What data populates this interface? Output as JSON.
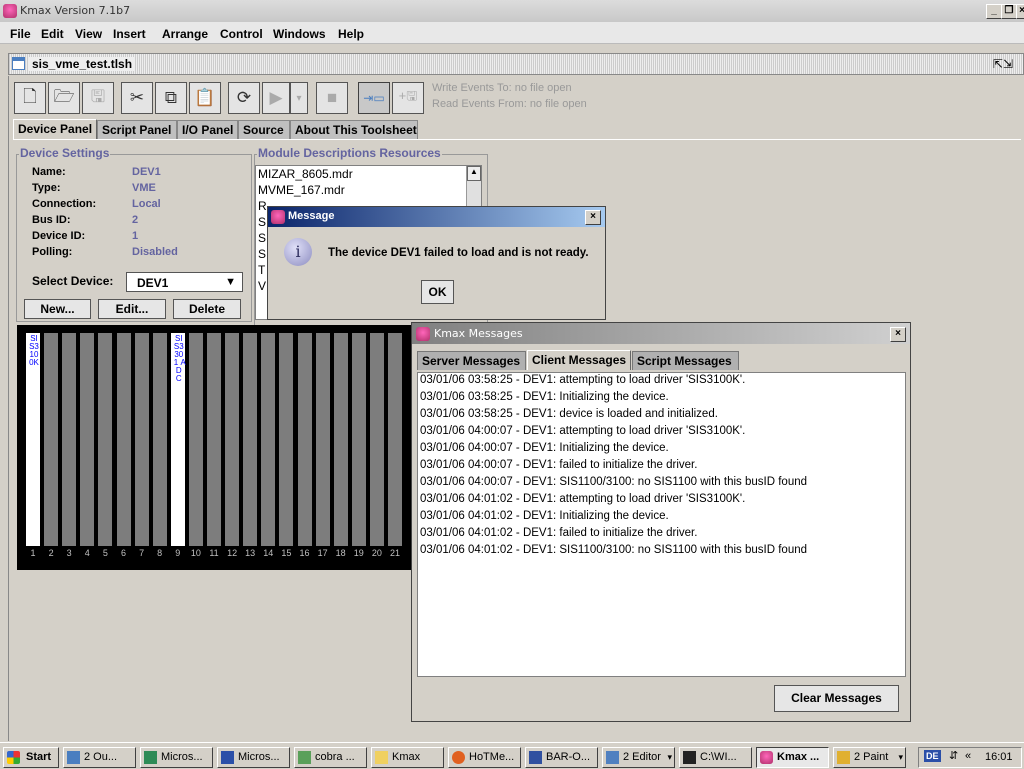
{
  "app": {
    "title": "Kmax Version 7.1b7"
  },
  "menu": [
    "File",
    "Edit",
    "View",
    "Insert",
    "Arrange",
    "Control",
    "Windows",
    "Help"
  ],
  "document": {
    "title": "sis_vme_test.tlsh"
  },
  "toolbar": {
    "write_status": "Write Events To: no file open",
    "read_status": "Read Events From: no file open"
  },
  "tabs": [
    "Device Panel",
    "Script Panel",
    "I/O Panel",
    "Source",
    "About This Toolsheet"
  ],
  "device_settings": {
    "legend": "Device Settings",
    "fields": [
      {
        "label": "Name:",
        "value": "DEV1"
      },
      {
        "label": "Type:",
        "value": "VME"
      },
      {
        "label": "Connection:",
        "value": "Local"
      },
      {
        "label": "Bus ID:",
        "value": "2"
      },
      {
        "label": "Device ID:",
        "value": "1"
      },
      {
        "label": "Polling:",
        "value": "Disabled"
      }
    ],
    "select_label": "Select Device:",
    "selected_device": "DEV1",
    "buttons": {
      "new": "New...",
      "edit": "Edit...",
      "delete": "Delete"
    }
  },
  "module_resources": {
    "legend": "Module Descriptions Resources",
    "items": [
      "MIZAR_8605.mdr",
      "MVME_167.mdr",
      "R",
      "S",
      "S",
      "S",
      "T",
      "V"
    ]
  },
  "crate": {
    "slot_numbers": [
      "1",
      "2",
      "3",
      "4",
      "5",
      "6",
      "7",
      "8",
      "9",
      "10",
      "11",
      "12",
      "13",
      "14",
      "15",
      "16",
      "17",
      "18",
      "19",
      "20",
      "21"
    ],
    "module_labels": {
      "slot1": "SIS3100K",
      "slot9": "SIS3301 ADC"
    }
  },
  "message_dialog": {
    "title": "Message",
    "text": "The device DEV1 failed to load and is not ready.",
    "ok": "OK"
  },
  "kmax_messages": {
    "title": "Kmax Messages",
    "tabs": [
      "Server Messages",
      "Client Messages",
      "Script Messages"
    ],
    "lines": [
      "03/01/06 03:58:25 - DEV1: attempting to load driver 'SIS3100K'.",
      "03/01/06 03:58:25 - DEV1: Initializing the device.",
      "03/01/06 03:58:25 - DEV1: device is loaded and initialized.",
      "03/01/06 04:00:07 - DEV1: attempting to load driver 'SIS3100K'.",
      "03/01/06 04:00:07 - DEV1: Initializing the device.",
      "03/01/06 04:00:07 - DEV1: failed to initialize the driver.",
      "03/01/06 04:00:07 - DEV1: SIS1100/3100: no SIS1100 with this busID found",
      "03/01/06 04:01:02 - DEV1: attempting to load driver 'SIS3100K'.",
      "03/01/06 04:01:02 - DEV1: Initializing the device.",
      "03/01/06 04:01:02 - DEV1: failed to initialize the driver.",
      "03/01/06 04:01:02 - DEV1: SIS1100/3100: no SIS1100 with this busID found"
    ],
    "clear_button": "Clear Messages"
  },
  "taskbar": {
    "start": "Start",
    "tasks": [
      "2 Ou...",
      "Micros...",
      "Micros...",
      "cobra ...",
      "Kmax",
      "HoTMe...",
      "BAR-O...",
      "2 Editor",
      "C:\\WI...",
      "Kmax ...",
      "2 Paint"
    ],
    "lang": "DE",
    "clock": "16:01"
  }
}
